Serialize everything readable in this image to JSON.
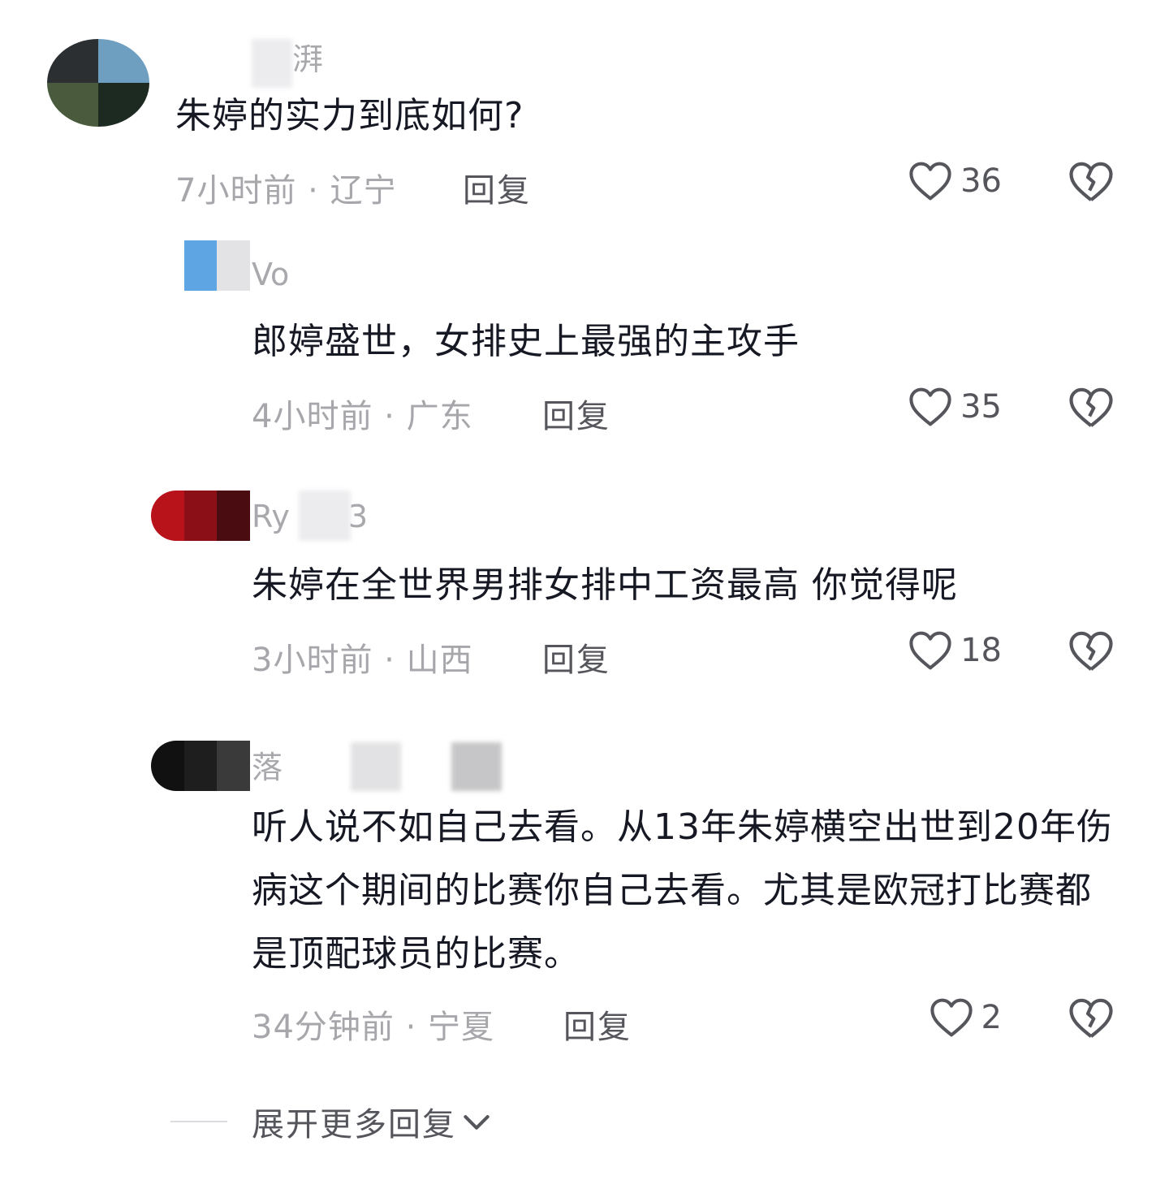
{
  "comments": [
    {
      "username": "湃",
      "content": "朱婷的实力到底如何?",
      "time_location": "7小时前 · 辽宁",
      "reply_label": "回复",
      "likes": "36"
    },
    {
      "username": "Vo",
      "content": "郎婷盛世，女排史上最强的主攻手",
      "time_location": "4小时前 · 广东",
      "reply_label": "回复",
      "likes": "35"
    },
    {
      "username": "Ry  3",
      "content": "朱婷在全世界男排女排中工资最高 你觉得呢",
      "time_location": "3小时前 · 山西",
      "reply_label": "回复",
      "likes": "18"
    },
    {
      "username": "落",
      "content": "听人说不如自己去看。从13年朱婷横空出世到20年伤病这个期间的比赛你自己去看。尤其是欧冠打比赛都是顶配球员的比赛。",
      "time_location": "34分钟前 · 宁夏",
      "reply_label": "回复",
      "likes": "2"
    }
  ],
  "expand_more": "展开更多回复",
  "icons": {
    "like": "heart-outline-icon",
    "dislike": "broken-heart-icon",
    "expand": "chevron-down-icon"
  },
  "colors": {
    "text": "#161823",
    "meta": "#a6a6ab",
    "action": "#55555c"
  }
}
